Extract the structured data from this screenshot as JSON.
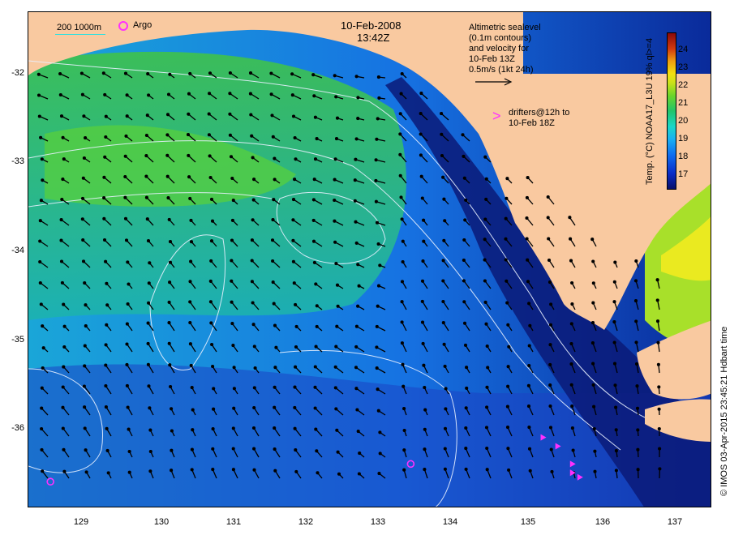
{
  "header": {
    "date": "10-Feb-2008",
    "time": "13:42Z"
  },
  "legend": {
    "isobath": "200  1000m",
    "argo": "Argo",
    "altimetry_lines": [
      "Altimetric sealevel",
      "(0.1m contours)",
      "and velocity for",
      "10-Feb 13Z",
      "0.5m/s (1kt 24h)"
    ],
    "drifter_symbol": ">",
    "drifter_lines": [
      "drifters@12h to",
      "10-Feb 18Z"
    ]
  },
  "axes": {
    "y_labels": [
      "-32",
      "-33",
      "-34",
      "-35",
      "-36"
    ],
    "x_labels": [
      "129",
      "130",
      "131",
      "132",
      "133",
      "134",
      "135",
      "136",
      "137"
    ]
  },
  "colorbar": {
    "labels": [
      "24",
      "23",
      "22",
      "21",
      "20",
      "19",
      "18",
      "17"
    ],
    "title": "Temp. (°C) NOAA17_L3U 19% ql>=4",
    "range": [
      16.3,
      24.7
    ]
  },
  "credit": "© IMOS 03-Apr-2015 23:45:21 Hdbart time",
  "map": {
    "lon_range": [
      128.2,
      137.5
    ],
    "lat_range": [
      -36.9,
      -31.3
    ],
    "land_color": "#f9c9a0",
    "contour_color": "#e8f0ff",
    "argo_floats": [
      {
        "lon": 128.5,
        "lat": -36.6
      },
      {
        "lon": 133.4,
        "lat": -36.4
      }
    ],
    "drifters": [
      {
        "lon": 135.2,
        "lat": -36.1
      },
      {
        "lon": 135.4,
        "lat": -36.2
      },
      {
        "lon": 135.6,
        "lat": -36.4
      },
      {
        "lon": 135.6,
        "lat": -36.5
      },
      {
        "lon": 135.7,
        "lat": -36.55
      }
    ]
  }
}
